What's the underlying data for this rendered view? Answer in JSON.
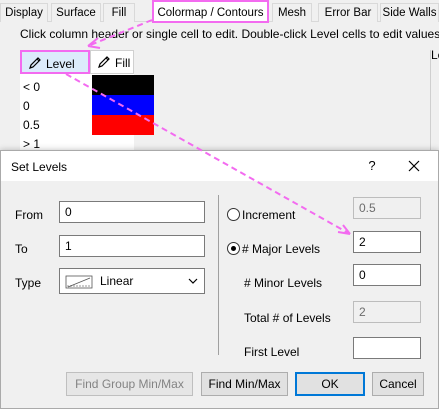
{
  "tabs": [
    {
      "label": "Display"
    },
    {
      "label": "Surface"
    },
    {
      "label": "Fill"
    },
    {
      "label": "Colormap / Contours"
    },
    {
      "label": "Mesh"
    },
    {
      "label": "Error Bar"
    },
    {
      "label": "Side Walls"
    }
  ],
  "instruction": "Click column header or single cell to edit. Double-click Level cells to edit values.",
  "grid": {
    "headers": {
      "level": "Level",
      "fill": "Fill"
    },
    "rows": [
      {
        "level": "< 0",
        "color": "#000000"
      },
      {
        "level": "0",
        "color": "#0000ff"
      },
      {
        "level": "0.5",
        "color": "#ff0000"
      },
      {
        "level": "> 1",
        "color": ""
      }
    ]
  },
  "right_fragment": "Le",
  "dialog": {
    "title": "Set Levels",
    "help": "?",
    "from_label": "From",
    "from_value": "0",
    "to_label": "To",
    "to_value": "1",
    "type_label": "Type",
    "type_value": "Linear",
    "increment_label": "Increment",
    "increment_value": "0.5",
    "major_label": "# Major Levels",
    "major_value": "2",
    "minor_label": "# Minor Levels",
    "minor_value": "0",
    "total_label": "Total # of Levels",
    "total_value": "2",
    "first_label": "First Level",
    "first_value": "",
    "buttons": {
      "find_group": "Find Group Min/Max",
      "find": "Find Min/Max",
      "ok": "OK",
      "cancel": "Cancel"
    }
  },
  "colors": {
    "highlight": "#f36bf0",
    "accent": "#0078d7"
  }
}
